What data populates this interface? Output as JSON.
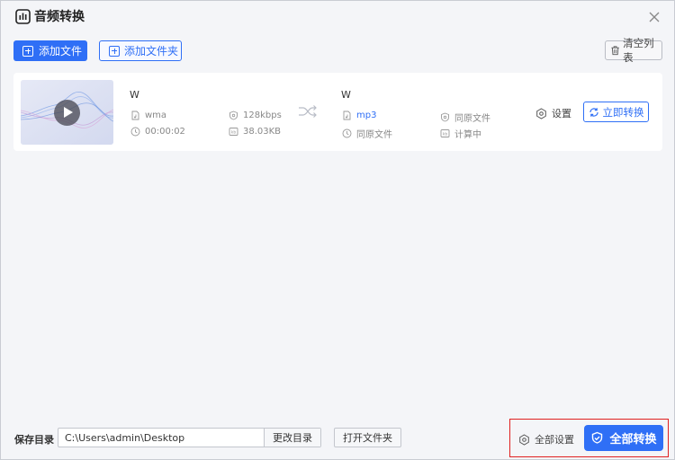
{
  "window": {
    "title": "音频转换"
  },
  "toolbar": {
    "add_file": "添加文件",
    "add_folder": "添加文件夹",
    "clear_list": "清空列表"
  },
  "file_item": {
    "source": {
      "name": "W",
      "format": "wma",
      "bitrate": "128kbps",
      "duration": "00:00:02",
      "size": "38.03KB"
    },
    "target": {
      "name": "W",
      "format": "mp3",
      "quality": "同原文件",
      "duration": "同原文件",
      "size": "计算中"
    },
    "settings_label": "设置",
    "convert_now_label": "立即转换"
  },
  "footer": {
    "save_label": "保存目录",
    "path": "C:\\Users\\admin\\Desktop",
    "change_dir": "更改目录",
    "open_folder": "打开文件夹",
    "all_settings": "全部设置",
    "convert_all": "全部转换"
  },
  "colors": {
    "accent": "#2f6ff6",
    "highlight_frame": "#e02020"
  },
  "icons": {
    "app": "audio-bars-icon",
    "close": "close-icon",
    "clear": "trash-icon",
    "shuffle": "shuffle-icon",
    "settings": "gear-icon",
    "convert": "refresh-icon",
    "convert_all": "shield-icon"
  }
}
